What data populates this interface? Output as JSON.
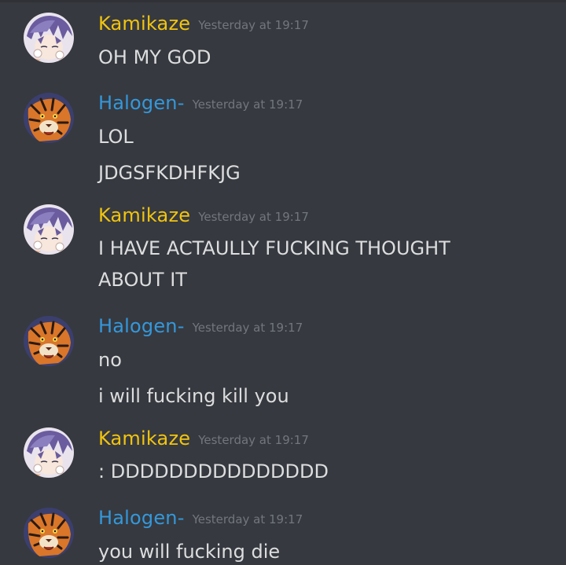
{
  "colors": {
    "background": "#36393f",
    "kamikaze_name": "#f1c40f",
    "halogen_name": "#3498db",
    "timestamp": "#72767d",
    "message_text": "#dcddde"
  },
  "messages": [
    {
      "author": "Kamikaze",
      "timestamp": "Yesterday at 19:17",
      "lines": [
        "OH MY GOD"
      ]
    },
    {
      "author": "Halogen-",
      "timestamp": "Yesterday at 19:17",
      "lines": [
        "LOL",
        "JDGSFKDHFKJG"
      ]
    },
    {
      "author": "Kamikaze",
      "timestamp": "Yesterday at 19:17",
      "lines": [
        "I HAVE ACTAULLY FUCKING THOUGHT",
        "ABOUT IT"
      ]
    },
    {
      "author": "Halogen-",
      "timestamp": "Yesterday at 19:17",
      "lines": [
        "no",
        "i will fucking kill you"
      ]
    },
    {
      "author": "Kamikaze",
      "timestamp": "Yesterday at 19:17",
      "lines": [
        ": DDDDDDDDDDDDDDD"
      ]
    },
    {
      "author": "Halogen-",
      "timestamp": "Yesterday at 19:17",
      "lines": [
        "you will fucking die"
      ]
    }
  ]
}
